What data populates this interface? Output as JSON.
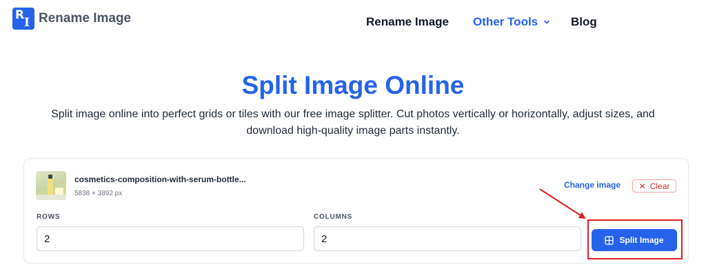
{
  "header": {
    "logo_text": "Rename Image",
    "logo_mark": {
      "r": "R",
      "i": "I"
    },
    "nav": {
      "rename_image": "Rename Image",
      "other_tools": "Other Tools",
      "blog": "Blog"
    }
  },
  "hero": {
    "title": "Split Image Online",
    "subtitle_line1": "Split image online into perfect grids or tiles with our free image splitter. Cut photos vertically or horizontally, adjust sizes, and",
    "subtitle_line2": "download high-quality image parts instantly."
  },
  "uploader": {
    "file_name": "cosmetics-composition-with-serum-bottle...",
    "dimensions": "5838 × 3892 px",
    "change_image_label": "Change image",
    "clear_label": "Clear",
    "rows_label": "ROWS",
    "rows_value": "2",
    "columns_label": "COLUMNS",
    "columns_value": "2",
    "split_button_label": "Split Image"
  },
  "colors": {
    "brand_blue": "#2563eb",
    "clear_red": "#dc2626",
    "annotation_red": "#e11d1d"
  },
  "icons": {
    "logo": "logo-mark-icon",
    "dropdown": "chevron-down-icon",
    "clear": "close-icon",
    "split": "grid-icon"
  }
}
